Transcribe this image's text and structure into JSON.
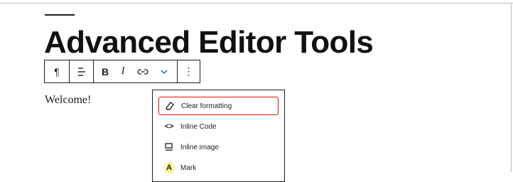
{
  "heading": "Advanced Editor Tools",
  "paragraph": "Welcome!",
  "toolbar": {
    "paragraph_glyph": "¶",
    "bold_label": "B",
    "italic_label": "I",
    "more_glyph": "⋮"
  },
  "dropdown": {
    "items": [
      {
        "label": "Clear formatting",
        "icon": "eraser-icon",
        "selected": true
      },
      {
        "label": "Inline Code",
        "icon": "code-brackets-icon",
        "glyph": "<>"
      },
      {
        "label": "Inline image",
        "icon": "inline-image-icon"
      },
      {
        "label": "Mark",
        "icon": "highlighter-icon",
        "glyph": "A"
      }
    ]
  },
  "colors": {
    "accent": "#007cba",
    "selected_outline": "#cc1818",
    "mark_highlight": "#fff3a3"
  }
}
